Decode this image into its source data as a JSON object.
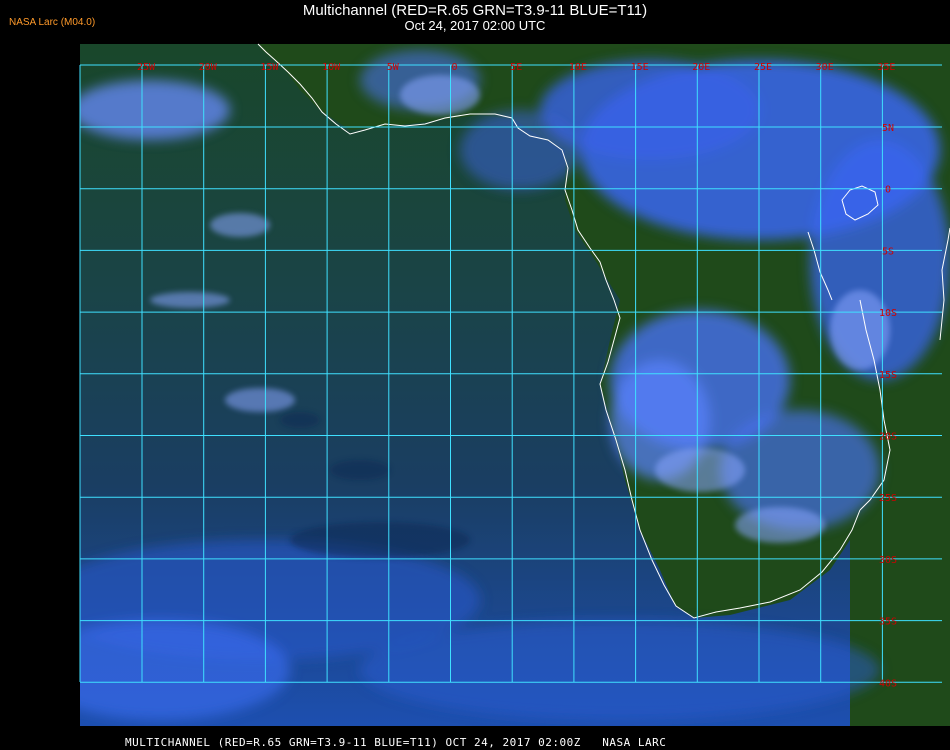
{
  "header": {
    "title": "Multichannel (RED=R.65 GRN=T3.9-11 BLUE=T11)",
    "datetime": "Oct 24, 2017 02:00 UTC",
    "credit": "NASA Larc (M04.0)"
  },
  "footer": {
    "text": "MULTICHANNEL (RED=R.65 GRN=T3.9-11 BLUE=T11) OCT 24, 2017 02:00Z   NASA LARC"
  },
  "map": {
    "region": "Southern Africa and South Atlantic",
    "lon_labels": [
      "25W",
      "20W",
      "15W",
      "10W",
      "5W",
      "0",
      "5E",
      "10E",
      "15E",
      "20E",
      "25E",
      "30E",
      "35E"
    ],
    "lat_labels": [
      "5N",
      "0",
      "5S",
      "10S",
      "15S",
      "20S",
      "25S",
      "30S",
      "35S",
      "40S"
    ],
    "colors": {
      "grid": "#3fe0ff",
      "coast": "#ffffff",
      "lon_label": "#d00000",
      "lat_label": "#d00000",
      "land": "#1d4418",
      "ocean": "#1a3f6a",
      "cloud": "#4a72ff"
    }
  }
}
